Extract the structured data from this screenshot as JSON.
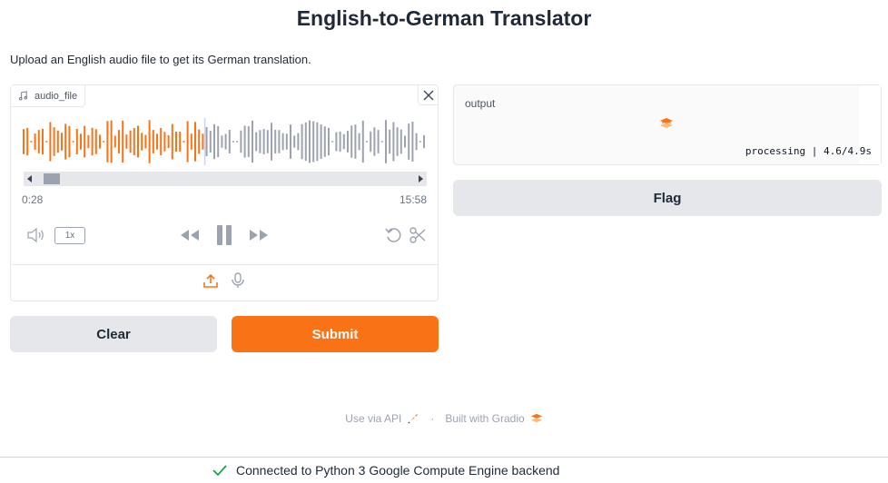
{
  "header": {
    "title": "English-to-German Translator",
    "description": "Upload an English audio file to get its German translation."
  },
  "audio_input": {
    "label": "audio_file",
    "current_time": "0:28",
    "duration": "15:58",
    "speed": "1x",
    "progress_fraction": 0.45
  },
  "buttons": {
    "clear": "Clear",
    "submit": "Submit",
    "flag": "Flag"
  },
  "output": {
    "label": "output",
    "progress_text": "processing | 4.6/4.9s"
  },
  "footer": {
    "api_link": "Use via API",
    "built_with": "Built with Gradio"
  },
  "status": {
    "text": "Connected to Python 3 Google Compute Engine backend"
  },
  "colors": {
    "accent": "#f97316",
    "played": "#f97316",
    "unplayed": "#9ca3af",
    "success": "#16a34a"
  }
}
